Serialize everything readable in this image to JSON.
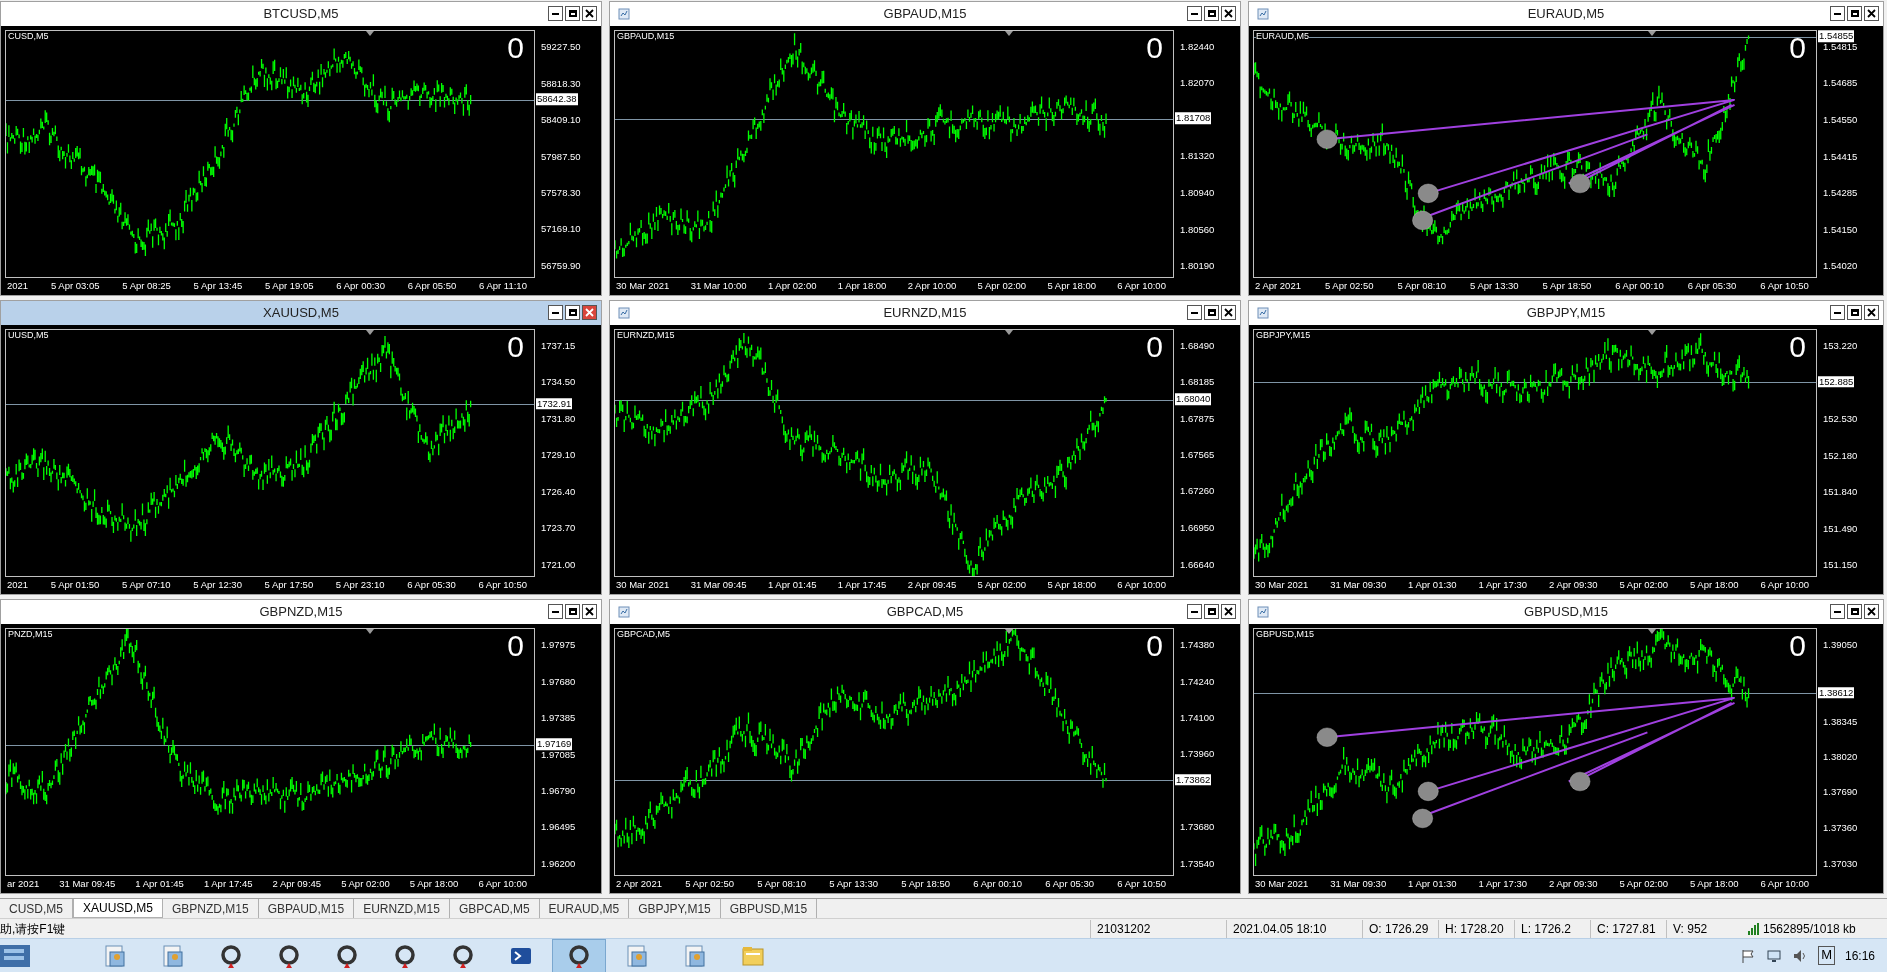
{
  "charts": [
    {
      "title": "BTCUSD,M5",
      "label": "CUSD,M5",
      "icon": false,
      "active": false,
      "trendlines": false,
      "zero": "0",
      "prices": [
        "59227.50",
        "58818.30",
        "58409.10",
        "57987.50",
        "57578.30",
        "57169.10",
        "56759.90"
      ],
      "current": "58642.38",
      "times": [
        "2021",
        "5 Apr 03:05",
        "5 Apr 08:25",
        "5 Apr 13:45",
        "5 Apr 19:05",
        "6 Apr 00:30",
        "6 Apr 05:50",
        "6 Apr 11:10"
      ]
    },
    {
      "title": "GBPAUD,M15",
      "label": "GBPAUD,M15",
      "icon": true,
      "active": false,
      "trendlines": false,
      "zero": "0",
      "prices": [
        "1.82440",
        "1.82070",
        "1.81320",
        "1.80940",
        "1.80560",
        "1.80190"
      ],
      "current": "1.81708",
      "times": [
        "30 Mar 2021",
        "31 Mar 10:00",
        "1 Apr 02:00",
        "1 Apr 18:00",
        "2 Apr 10:00",
        "5 Apr 02:00",
        "5 Apr 18:00",
        "6 Apr 10:00"
      ]
    },
    {
      "title": "EURAUD,M5",
      "label": "EURAUD,M5",
      "icon": true,
      "active": false,
      "trendlines": true,
      "zero": "0",
      "prices": [
        "1.54815",
        "1.54685",
        "1.54550",
        "1.54415",
        "1.54285",
        "1.54150",
        "1.54020"
      ],
      "current": "1.54855",
      "times": [
        "2 Apr 2021",
        "5 Apr 02:50",
        "5 Apr 08:10",
        "5 Apr 13:30",
        "5 Apr 18:50",
        "6 Apr 00:10",
        "6 Apr 05:30",
        "6 Apr 10:50"
      ]
    },
    {
      "title": "XAUUSD,M5",
      "label": "UUSD,M5",
      "icon": false,
      "active": true,
      "trendlines": false,
      "zero": "0",
      "prices": [
        "1737.15",
        "1734.50",
        "1731.80",
        "1729.10",
        "1726.40",
        "1723.70",
        "1721.00"
      ],
      "current": "1732.91",
      "times": [
        "2021",
        "5 Apr 01:50",
        "5 Apr 07:10",
        "5 Apr 12:30",
        "5 Apr 17:50",
        "5 Apr 23:10",
        "6 Apr 05:30",
        "6 Apr 10:50"
      ]
    },
    {
      "title": "EURNZD,M15",
      "label": "EURNZD,M15",
      "icon": true,
      "active": false,
      "trendlines": false,
      "zero": "0",
      "prices": [
        "1.68490",
        "1.68185",
        "1.67875",
        "1.67565",
        "1.67260",
        "1.66950",
        "1.66640"
      ],
      "current": "1.68040",
      "times": [
        "30 Mar 2021",
        "31 Mar 09:45",
        "1 Apr 01:45",
        "1 Apr 17:45",
        "2 Apr 09:45",
        "5 Apr 02:00",
        "5 Apr 18:00",
        "6 Apr 10:00"
      ]
    },
    {
      "title": "GBPJPY,M15",
      "label": "GBPJPY,M15",
      "icon": true,
      "active": false,
      "trendlines": false,
      "zero": "0",
      "prices": [
        "153.220",
        "152.530",
        "152.180",
        "151.840",
        "151.490",
        "151.150"
      ],
      "current": "152.885",
      "times": [
        "30 Mar 2021",
        "31 Mar 09:30",
        "1 Apr 01:30",
        "1 Apr 17:30",
        "2 Apr 09:30",
        "5 Apr 02:00",
        "5 Apr 18:00",
        "6 Apr 10:00"
      ]
    },
    {
      "title": "GBPNZD,M15",
      "label": "PNZD,M15",
      "icon": false,
      "active": false,
      "trendlines": false,
      "zero": "0",
      "prices": [
        "1.97975",
        "1.97680",
        "1.97385",
        "1.97085",
        "1.96790",
        "1.96495",
        "1.96200"
      ],
      "current": "1.97169",
      "times": [
        "ar 2021",
        "31 Mar 09:45",
        "1 Apr 01:45",
        "1 Apr 17:45",
        "2 Apr 09:45",
        "5 Apr 02:00",
        "5 Apr 18:00",
        "6 Apr 10:00"
      ]
    },
    {
      "title": "GBPCAD,M5",
      "label": "GBPCAD,M5",
      "icon": true,
      "active": false,
      "trendlines": false,
      "zero": "0",
      "prices": [
        "1.74380",
        "1.74240",
        "1.74100",
        "1.73960",
        "1.73680",
        "1.73540"
      ],
      "current": "1.73862",
      "times": [
        "2 Apr 2021",
        "5 Apr 02:50",
        "5 Apr 08:10",
        "5 Apr 13:30",
        "5 Apr 18:50",
        "6 Apr 00:10",
        "6 Apr 05:30",
        "6 Apr 10:50"
      ]
    },
    {
      "title": "GBPUSD,M15",
      "label": "GBPUSD,M15",
      "icon": true,
      "active": false,
      "trendlines": true,
      "zero": "0",
      "prices": [
        "1.39050",
        "1.38345",
        "1.38020",
        "1.37690",
        "1.37360",
        "1.37030"
      ],
      "current": "1.38612",
      "times": [
        "30 Mar 2021",
        "31 Mar 09:30",
        "1 Apr 01:30",
        "1 Apr 17:30",
        "2 Apr 09:30",
        "5 Apr 02:00",
        "5 Apr 18:00",
        "6 Apr 10:00"
      ]
    }
  ],
  "tabs": [
    {
      "label": "CUSD,M5",
      "selected": false
    },
    {
      "label": "XAUUSD,M5",
      "selected": true
    },
    {
      "label": "GBPNZD,M15",
      "selected": false
    },
    {
      "label": "GBPAUD,M15",
      "selected": false
    },
    {
      "label": "EURNZD,M15",
      "selected": false
    },
    {
      "label": "GBPCAD,M5",
      "selected": false
    },
    {
      "label": "EURAUD,M5",
      "selected": false
    },
    {
      "label": "GBPJPY,M15",
      "selected": false
    },
    {
      "label": "GBPUSD,M15",
      "selected": false
    }
  ],
  "status_bar": {
    "help": "助,请按F1键",
    "fields": [
      "21031202",
      "2021.04.05 18:10",
      "O: 1726.29",
      "H: 1728.20",
      "L: 1726.2",
      "C: 1727.81",
      "V: 952"
    ],
    "traffic": "1562895/1018 kb"
  },
  "taskbar": {
    "apps": [
      {
        "kind": "doc",
        "selected": false
      },
      {
        "kind": "doc",
        "selected": false
      },
      {
        "kind": "ring",
        "selected": false
      },
      {
        "kind": "ring",
        "selected": false
      },
      {
        "kind": "ring",
        "selected": false
      },
      {
        "kind": "ring",
        "selected": false
      },
      {
        "kind": "ring",
        "selected": false
      },
      {
        "kind": "shell",
        "selected": false
      },
      {
        "kind": "ring",
        "selected": true
      },
      {
        "kind": "doc",
        "selected": false
      },
      {
        "kind": "doc",
        "selected": false
      },
      {
        "kind": "folder",
        "selected": false
      }
    ],
    "clock": "16:16",
    "ime": "M"
  }
}
